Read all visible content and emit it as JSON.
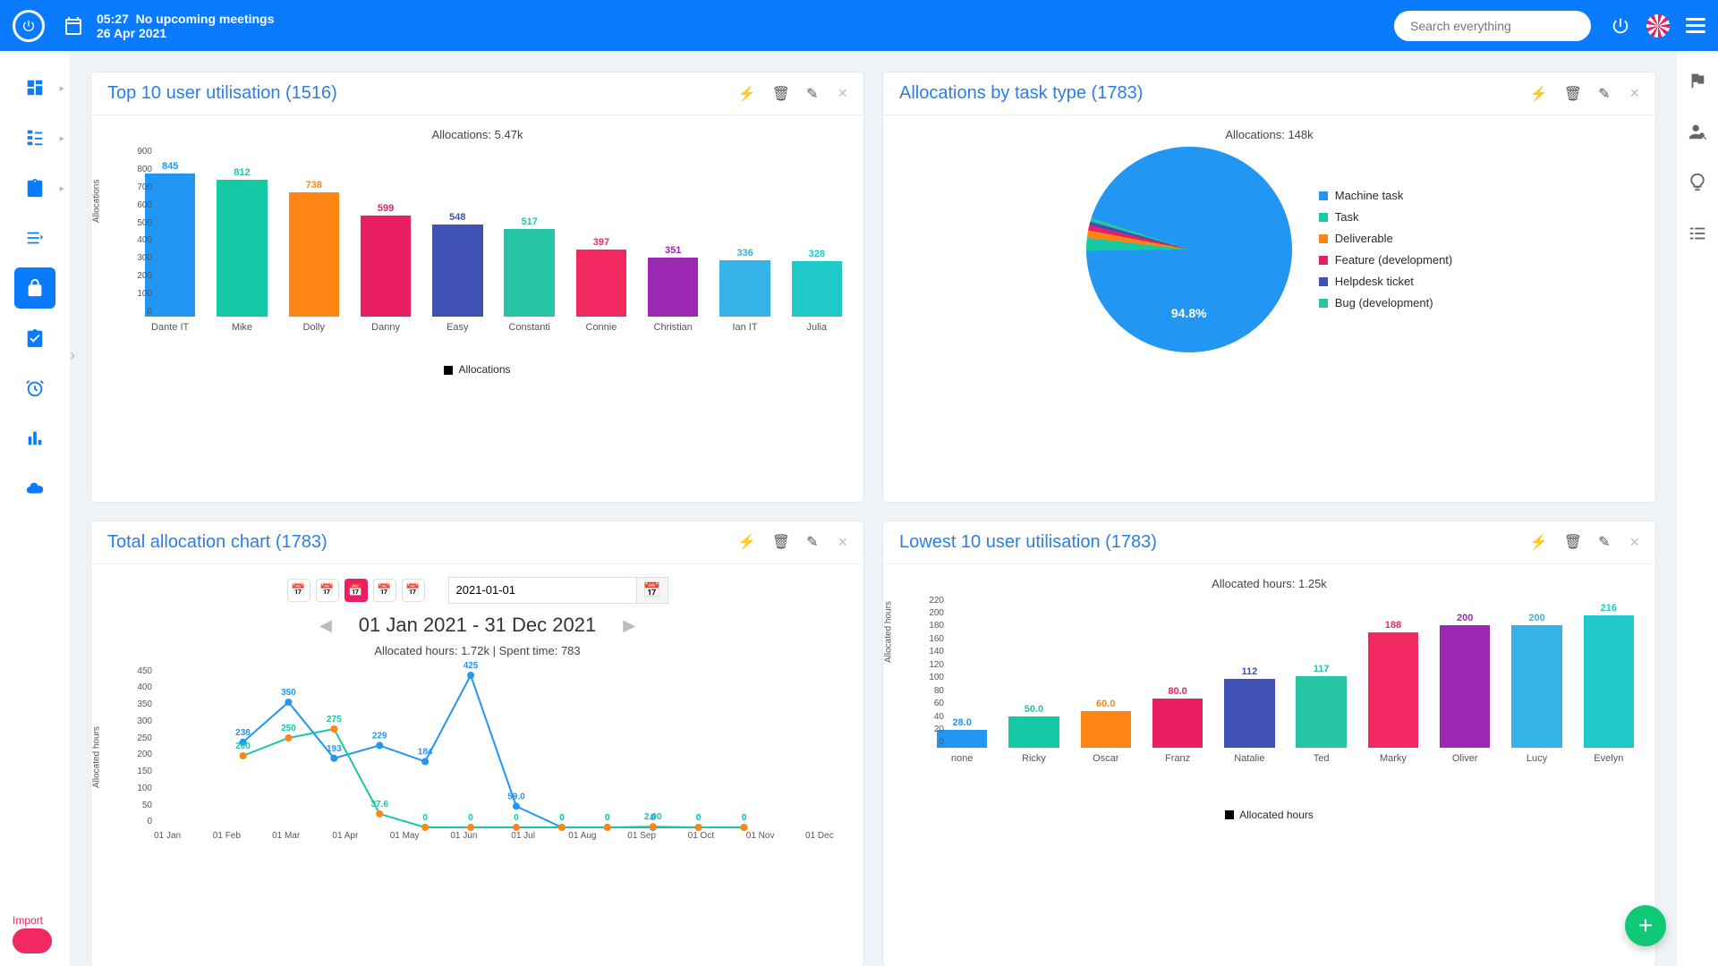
{
  "header": {
    "time": "05:27",
    "meeting_status": "No upcoming meetings",
    "date": "26 Apr 2021",
    "search_placeholder": "Search everything"
  },
  "cards": {
    "utilTop": {
      "title": "Top 10 user utilisation (1516)",
      "subtitle": "Allocations: 5.47k",
      "ylabel": "Allocations",
      "legend": "Allocations"
    },
    "taskType": {
      "title": "Allocations by task type (1783)",
      "subtitle": "Allocations: 148k",
      "pie_label": "94.8%"
    },
    "total": {
      "title": "Total allocation chart (1783)",
      "date_value": "2021-01-01",
      "range": "01 Jan 2021 - 31 Dec 2021",
      "subtitle": "Allocated hours: 1.72k | Spent time: 783",
      "ylabel": "Allocated hours"
    },
    "utilLow": {
      "title": "Lowest 10 user utilisation (1783)",
      "subtitle": "Allocated hours: 1.25k",
      "ylabel": "Allocated hours",
      "legend": "Allocated hours"
    }
  },
  "pie_legend": [
    {
      "label": "Machine task",
      "color": "#2196f3"
    },
    {
      "label": "Task",
      "color": "#14c9a3"
    },
    {
      "label": "Deliverable",
      "color": "#ff8514"
    },
    {
      "label": "Feature (development)",
      "color": "#e91e63"
    },
    {
      "label": "Helpdesk ticket",
      "color": "#3f51b5"
    },
    {
      "label": "Bug (development)",
      "color": "#26c6a4"
    }
  ],
  "chart_data": [
    {
      "id": "utilTop",
      "type": "bar",
      "title": "Top 10 user utilisation (1516)",
      "subtitle": "Allocations: 5.47k",
      "ylabel": "Allocations",
      "ylim": [
        0,
        900
      ],
      "yticks": [
        0,
        100,
        200,
        300,
        400,
        500,
        600,
        700,
        800,
        900
      ],
      "categories": [
        "Dante IT",
        "Mike",
        "Dolly",
        "Danny",
        "Easy",
        "Constanti",
        "Connie",
        "Christian",
        "Ian IT",
        "Julia"
      ],
      "values": [
        845,
        812,
        738,
        599,
        548,
        517,
        397,
        351,
        336,
        328
      ],
      "colors": [
        "#2196f3",
        "#14c9a3",
        "#ff8514",
        "#e91e63",
        "#3f51b5",
        "#26c6a4",
        "#f22860",
        "#9c27b0",
        "#35b2e8",
        "#20c9c9"
      ],
      "legend": "Allocations"
    },
    {
      "id": "taskType",
      "type": "pie",
      "title": "Allocations by task type (1783)",
      "subtitle": "Allocations: 148k",
      "series": [
        {
          "name": "Machine task",
          "value": 94.8,
          "color": "#2196f3"
        },
        {
          "name": "Task",
          "value": 2.0,
          "color": "#14c9a3"
        },
        {
          "name": "Deliverable",
          "value": 1.2,
          "color": "#ff8514"
        },
        {
          "name": "Feature (development)",
          "value": 0.8,
          "color": "#e91e63"
        },
        {
          "name": "Helpdesk ticket",
          "value": 0.6,
          "color": "#3f51b5"
        },
        {
          "name": "Bug (development)",
          "value": 0.6,
          "color": "#26c6a4"
        }
      ],
      "dominant_label": "94.8%"
    },
    {
      "id": "total",
      "type": "line",
      "title": "Total allocation chart (1783)",
      "subtitle": "Allocated hours: 1.72k | Spent time: 783",
      "range": "01 Jan 2021 - 31 Dec 2021",
      "ylabel": "Allocated hours",
      "ylim": [
        0,
        450
      ],
      "yticks": [
        0,
        50,
        100,
        150,
        200,
        250,
        300,
        350,
        400,
        450
      ],
      "categories": [
        "01 Jan",
        "01 Feb",
        "01 Mar",
        "01 Apr",
        "01 May",
        "01 Jun",
        "01 Jul",
        "01 Aug",
        "01 Sep",
        "01 Oct",
        "01 Nov",
        "01 Dec"
      ],
      "series": [
        {
          "name": "Allocated hours",
          "color": "#2196f3",
          "values": [
            238,
            350,
            193,
            229,
            184,
            425,
            59.0,
            0,
            0,
            0,
            0,
            0
          ],
          "labels": [
            "238",
            "350",
            "193",
            "229",
            "184",
            "425",
            "59.0",
            "0",
            "0",
            "0",
            "0",
            "0"
          ]
        },
        {
          "name": "Spent time",
          "color": "#14c9a3",
          "values": [
            200,
            250,
            275,
            37.6,
            0,
            0,
            0,
            0,
            0,
            2.0,
            0,
            0
          ],
          "labels": [
            "200",
            "250",
            "275",
            "37.6",
            "0",
            "0",
            "0",
            "0",
            "0",
            "2.00",
            "0",
            "0"
          ],
          "marker_color": "#ff8514"
        }
      ]
    },
    {
      "id": "utilLow",
      "type": "bar",
      "title": "Lowest 10 user utilisation (1783)",
      "subtitle": "Allocated hours: 1.25k",
      "ylabel": "Allocated hours",
      "ylim": [
        0,
        220
      ],
      "yticks": [
        0,
        20,
        40,
        60,
        80,
        100,
        120,
        140,
        160,
        180,
        200,
        220
      ],
      "categories": [
        "none",
        "Ricky",
        "Oscar",
        "Franz",
        "Natalie",
        "Ted",
        "Marky",
        "Oliver",
        "Lucy",
        "Evelyn"
      ],
      "values": [
        28.0,
        50.0,
        60.0,
        80.0,
        112,
        117,
        188,
        200,
        200,
        216
      ],
      "labels": [
        "28.0",
        "50.0",
        "60.0",
        "80.0",
        "112",
        "117",
        "188",
        "200",
        "200",
        "216"
      ],
      "colors": [
        "#2196f3",
        "#14c9a3",
        "#ff8514",
        "#e91e63",
        "#3f51b5",
        "#26c6a4",
        "#f22860",
        "#9c27b0",
        "#35b2e8",
        "#20c9c9"
      ],
      "legend": "Allocated hours"
    }
  ]
}
